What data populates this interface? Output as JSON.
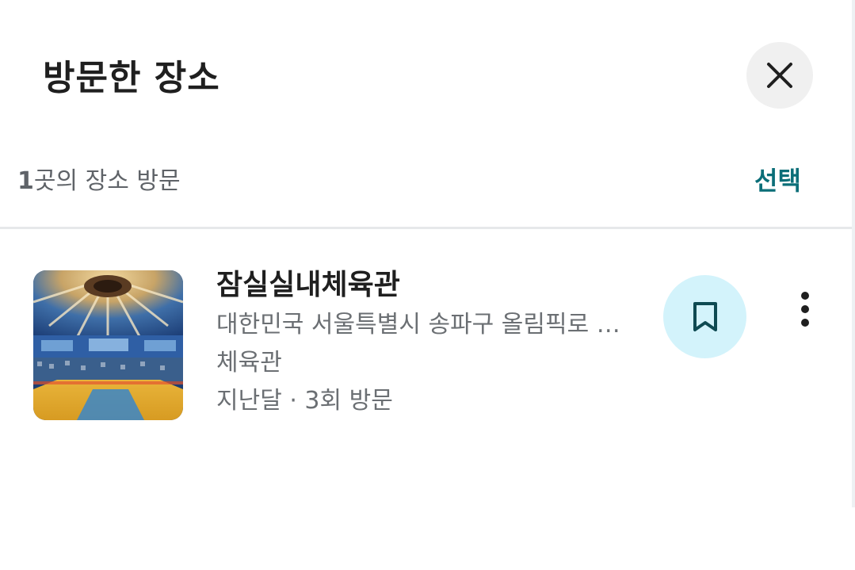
{
  "header": {
    "title": "방문한 장소",
    "close_icon": "close-icon"
  },
  "summary": {
    "count": "1",
    "text": "곳의 장소 방문",
    "select_label": "선택"
  },
  "places": [
    {
      "name": "잠실실내체육관",
      "address": "대한민국 서울특별시 송파구 올림픽로 …",
      "category": "체육관",
      "visits": "지난달 · 3회 방문",
      "thumbnail": "indoor-arena-photo",
      "save_icon": "bookmark-icon",
      "more_icon": "more-vert-icon"
    }
  ],
  "colors": {
    "accent": "#0b6e78",
    "save_bg": "#d3f3fb",
    "close_bg": "#f0f0f0",
    "primary_text": "#1f1f1f",
    "secondary_text": "#6b6f73",
    "divider": "#e6e8ea"
  }
}
